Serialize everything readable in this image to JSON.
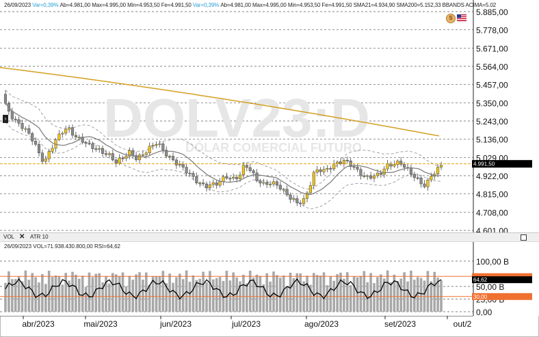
{
  "header": {
    "date": "26/09/2023",
    "var": "Var=0,39%",
    "ab": "Ab=4.981,00",
    "max": "Max=4.995,00",
    "min": "Min=4.953,50",
    "fe": "Fe=4.991,50",
    "var2": "Var=0,39%",
    "ab2": "Ab=4.981,00",
    "max2": "Max=4.995,00",
    "min2": "Min=4.953,50",
    "fe2": "Fe=4.991,50",
    "sma21": "SMA21=4.934,90",
    "sma200": "SMA200=5.152,33",
    "bbands": "BBANDS ACIMA=5.02"
  },
  "watermark": {
    "symbol": "DOLV23:D",
    "name": "DÓLAR COMERCIAL FUTURO"
  },
  "price_axis": {
    "labels": [
      "5.885,00",
      "5.778,00",
      "5.671,00",
      "5.564,00",
      "5.457,00",
      "5.350,00",
      "5.243,00",
      "5.136,00",
      "5.029,00",
      "4.922,00",
      "4.815,00",
      "4.708,00",
      "4.601,00"
    ],
    "values": [
      5885,
      5778,
      5671,
      5564,
      5457,
      5350,
      5243,
      5136,
      5029,
      4922,
      4815,
      4708,
      4601
    ],
    "current_price": "4.991,50",
    "current_value": 4991.5
  },
  "sub_panel": {
    "tab_vol": "VOL",
    "tab_atr": "ATR 10",
    "date": "26/09/2023",
    "vol": "VOL=71.938.430.800,00",
    "rsi": "RSI=64,62"
  },
  "vol_axis": {
    "labels": [
      "100,00 B",
      "50,00 B",
      "25,00 B",
      "0,00"
    ],
    "rsi_current": "64,62",
    "rsi_level": "30,00"
  },
  "time_axis": {
    "labels": [
      "abr/2023",
      "mai/2023",
      "jun/2023",
      "jul/2023",
      "ago/2023",
      "set/2023",
      "out/2"
    ]
  },
  "colors": {
    "bull": "#f0c419",
    "bear": "#8c8c8c",
    "sma21": "#808080",
    "sma200": "#d4a020",
    "bands": "#a0a0a0",
    "price_line": "#e0a000",
    "rsi_level": "#f07030"
  },
  "icons": {
    "currency": "s-coin-icon",
    "flag": "us-flag-icon"
  }
}
